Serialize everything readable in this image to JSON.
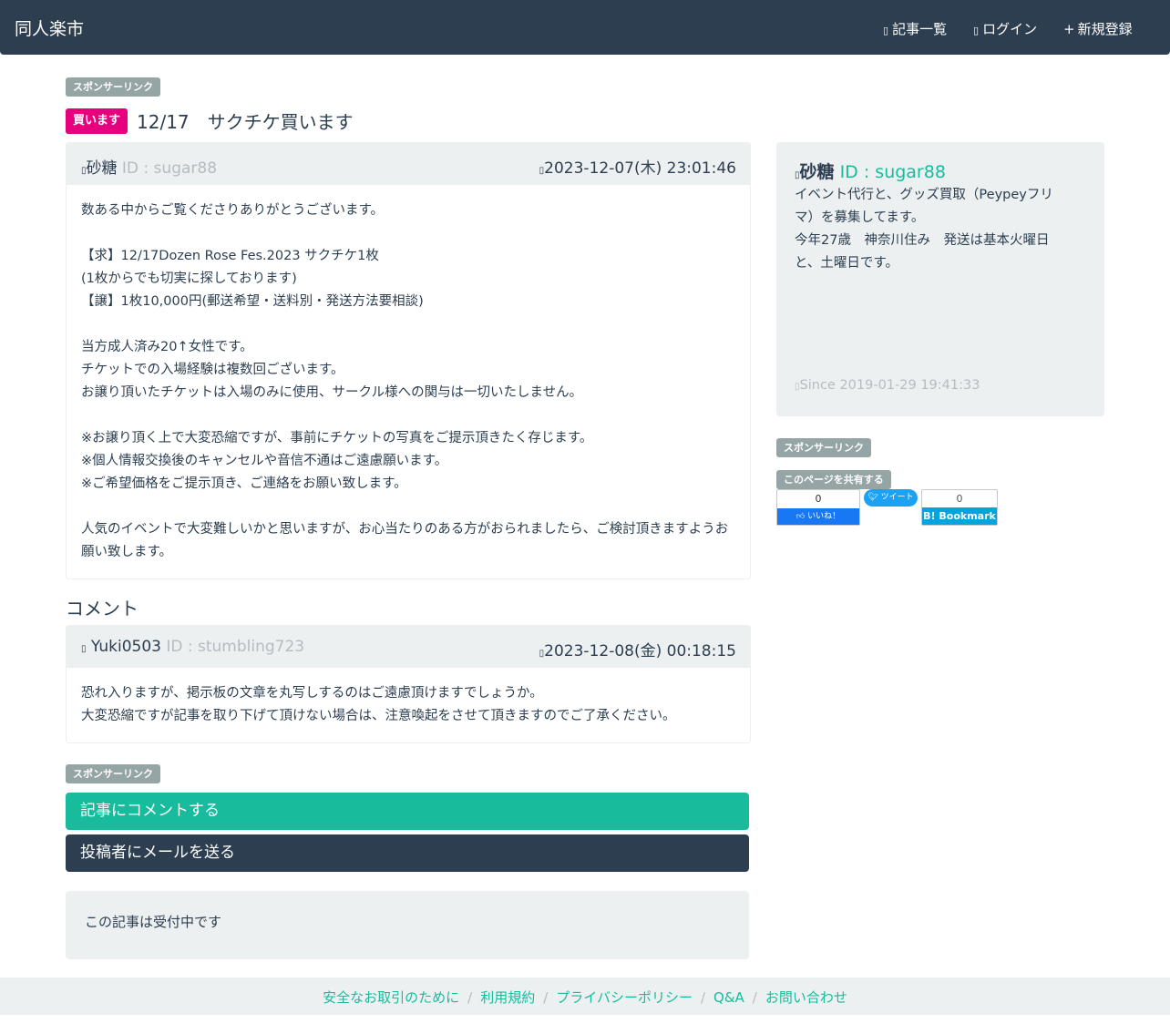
{
  "header": {
    "brand": "同人楽市",
    "nav": [
      {
        "icon": "list-icon",
        "glyph": "▯",
        "label": "記事一覧"
      },
      {
        "icon": "login-icon",
        "glyph": "▯",
        "label": "ログイン"
      },
      {
        "icon": "plus-icon",
        "glyph": "+",
        "label": "新規登録"
      }
    ]
  },
  "sponsor_label": "スポンサーリンク",
  "post": {
    "type_badge": "買います",
    "title": "12/17　サクチケ買います",
    "author_name": "砂糖",
    "author_id": "ID : sugar88",
    "date": "2023-12-07(木) 23:01:46",
    "body_lines": [
      "数ある中からご覧くださりありがとうございます。",
      "",
      "【求】12/17Dozen Rose Fes.2023 サクチケ1枚",
      "(1枚からでも切実に探しております)",
      "【譲】1枚10,000円(郵送希望・送料別・発送方法要相談)",
      "",
      "当方成人済み20↑女性です。",
      "チケットでの入場経験は複数回ございます。",
      "お譲り頂いたチケットは入場のみに使用、サークル様への関与は一切いたしません。",
      "",
      "※お譲り頂く上で大変恐縮ですが、事前にチケットの写真をご提示頂きたく存じます。",
      "※個人情報交換後のキャンセルや音信不通はご遠慮願います。",
      "※ご希望価格をご提示頂き、ご連絡をお願い致します。",
      "",
      "人気のイベントで大変難しいかと思いますが、お心当たりのある方がおられましたら、ご検討頂きますようお願い致します。"
    ]
  },
  "comments_title": "コメント",
  "comment": {
    "author_name": "Yuki0503",
    "author_id": "ID : stumbling723",
    "date": "2023-12-08(金) 00:18:15",
    "body_lines": [
      "恐れ入りますが、掲示板の文章を丸写しするのはご遠慮頂けますでしょうか。",
      "大変恐縮ですが記事を取り下げて頂けない場合は、注意喚起をさせて頂きますのでご了承ください。"
    ]
  },
  "actions": {
    "comment_button": "記事にコメントする",
    "mail_button": "投稿者にメールを送る",
    "status": "この記事は受付中です"
  },
  "profile": {
    "name": "砂糖",
    "id": "ID : sugar88",
    "desc_lines": [
      "イベント代行と、グッズ買取（Peypeyフリマ）を募集してます。",
      "今年27歳　神奈川住み　発送は基本火曜日と、土曜日です。"
    ],
    "since": "Since 2019-01-29 19:41:33"
  },
  "share": {
    "label": "このページを共有する",
    "fb_count": "0",
    "fb_label": "いいね！",
    "tw_label": "ツイート",
    "hb_count": "0",
    "hb_label": "B! Bookmark"
  },
  "footer": {
    "links": [
      "安全なお取引のために",
      "利用規約",
      "プライバシーポリシー",
      "Q&A",
      "お問い合わせ"
    ]
  },
  "colors": {
    "navbar": "#2c3e50",
    "accent": "#18bc9c",
    "buy_badge": "#e6007e",
    "muted": "#b4bcc2",
    "panel": "#ecf0f1"
  }
}
